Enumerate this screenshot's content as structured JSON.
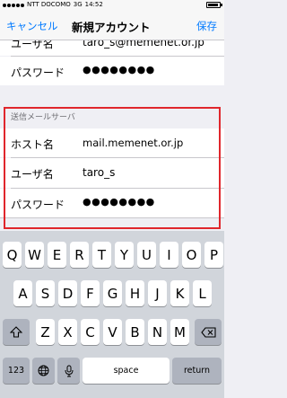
{
  "status_bar": {
    "carrier": "NTT DOCOMO",
    "network": "3G",
    "time": "14:52"
  },
  "nav": {
    "cancel_label": "キャンセル",
    "title": "新規アカウント",
    "save_label": "保存"
  },
  "incoming_partial": {
    "username_label": "ユーザ名",
    "username_value": "taro_s@memenet.or.jp",
    "password_label": "パスワード",
    "password_value": "●●●●●●●●"
  },
  "outgoing": {
    "header": "送信メールサーバ",
    "host_label": "ホスト名",
    "host_value": "mail.memenet.or.jp",
    "username_label": "ユーザ名",
    "username_value": "taro_s",
    "password_label": "パスワード",
    "password_value": "●●●●●●●●"
  },
  "keyboard": {
    "row1": [
      "Q",
      "W",
      "E",
      "R",
      "T",
      "Y",
      "U",
      "I",
      "O",
      "P"
    ],
    "row2": [
      "A",
      "S",
      "D",
      "F",
      "G",
      "H",
      "J",
      "K",
      "L"
    ],
    "row3": [
      "Z",
      "X",
      "C",
      "V",
      "B",
      "N",
      "M"
    ],
    "numbers_label": "123",
    "space_label": "space",
    "return_label": "return"
  }
}
